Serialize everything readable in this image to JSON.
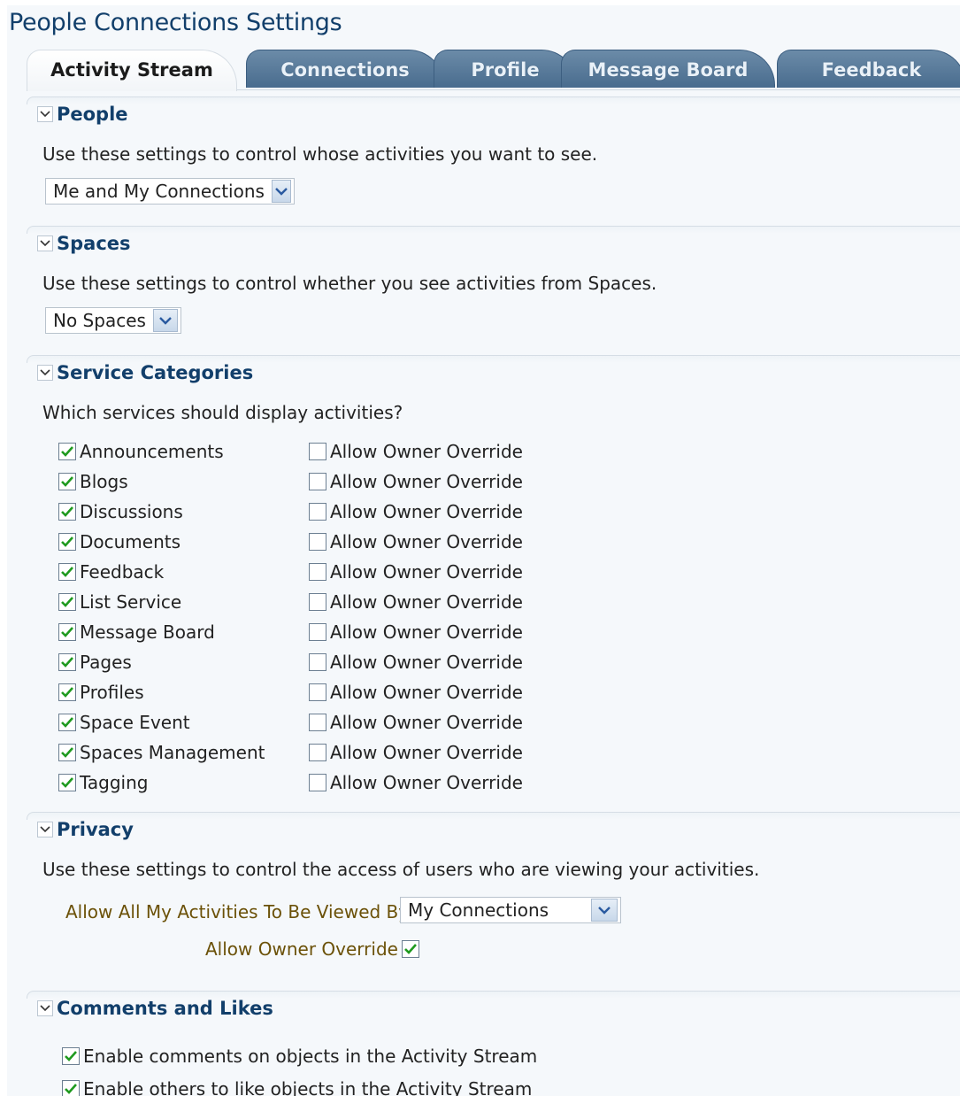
{
  "page": {
    "title": "People Connections Settings"
  },
  "tabs": [
    {
      "label": "Activity Stream",
      "active": true
    },
    {
      "label": "Connections",
      "active": false
    },
    {
      "label": "Profile",
      "active": false
    },
    {
      "label": "Message Board",
      "active": false
    },
    {
      "label": "Feedback",
      "active": false
    }
  ],
  "sections": {
    "people": {
      "title": "People",
      "description": "Use these settings to control whose activities you want to see.",
      "select_value": "Me and My Connections"
    },
    "spaces": {
      "title": "Spaces",
      "description": "Use these settings to control whether you see activities from Spaces.",
      "select_value": "No Spaces"
    },
    "services": {
      "title": "Service Categories",
      "question": "Which services should display activities?",
      "override_label": "Allow Owner Override",
      "items": [
        {
          "label": "Announcements",
          "checked": true,
          "override": false
        },
        {
          "label": "Blogs",
          "checked": true,
          "override": false
        },
        {
          "label": "Discussions",
          "checked": true,
          "override": false
        },
        {
          "label": "Documents",
          "checked": true,
          "override": false
        },
        {
          "label": "Feedback",
          "checked": true,
          "override": false
        },
        {
          "label": "List Service",
          "checked": true,
          "override": false
        },
        {
          "label": "Message Board",
          "checked": true,
          "override": false
        },
        {
          "label": "Pages",
          "checked": true,
          "override": false
        },
        {
          "label": "Profiles",
          "checked": true,
          "override": false
        },
        {
          "label": "Space Event",
          "checked": true,
          "override": false
        },
        {
          "label": "Spaces Management",
          "checked": true,
          "override": false
        },
        {
          "label": "Tagging",
          "checked": true,
          "override": false
        }
      ]
    },
    "privacy": {
      "title": "Privacy",
      "description": "Use these settings to control the access of users who are viewing your activities.",
      "viewed_by_label": "Allow All My Activities To Be Viewed By",
      "viewed_by_value": "My Connections",
      "override_label": "Allow Owner Override",
      "override_checked": true
    },
    "comments": {
      "title": "Comments and Likes",
      "enable_comments_label": "Enable comments on objects in the Activity Stream",
      "enable_comments_checked": true,
      "enable_likes_label": "Enable others to like objects in the Activity Stream",
      "enable_likes_checked": true
    }
  },
  "colors": {
    "heading": "#123f6b",
    "tab_inactive": "#5a7b9b",
    "check": "#1f9a1f",
    "privacy_label": "#6b5108"
  },
  "icons": {
    "collapse": "chevron-down-icon",
    "dropdown": "dropdown-arrow-icon",
    "check": "checkmark-icon"
  }
}
